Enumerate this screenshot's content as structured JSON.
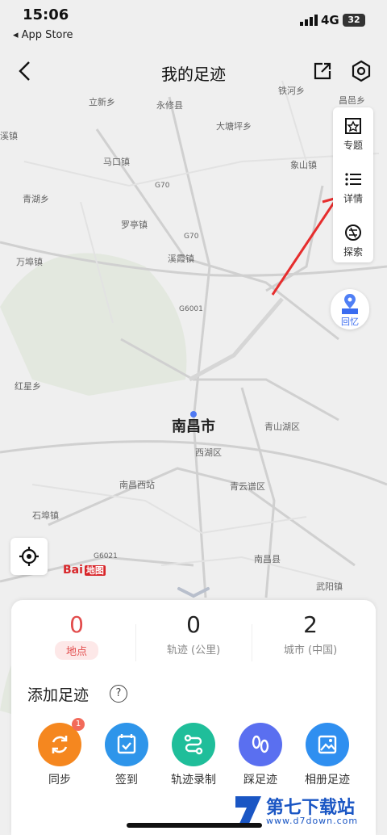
{
  "status_bar": {
    "time": "15:06",
    "back_app": "◂ App Store",
    "network": "4G",
    "battery": "32"
  },
  "header": {
    "title": "我的足迹"
  },
  "side_panel": {
    "items": [
      {
        "label": "专题"
      },
      {
        "label": "详情"
      },
      {
        "label": "探索"
      }
    ]
  },
  "memory_button": {
    "label": "回忆"
  },
  "map": {
    "city_label": "南昌市",
    "labels": [
      "立新乡",
      "永修县",
      "大塘坪乡",
      "马口镇",
      "象山镇",
      "铁河乡",
      "昌邑乡",
      "青湖乡",
      "罗亭镇",
      "溪霞镇",
      "万埠镇",
      "红星乡",
      "青山湖区",
      "西湖区",
      "南昌西站",
      "青云谱区",
      "石埠镇",
      "南昌县",
      "武阳镇",
      "溪镇",
      "G70",
      "G70",
      "G6001",
      "G6021"
    ],
    "logo": "Bai",
    "logo_map_word": "地图"
  },
  "stats": [
    {
      "value": "0",
      "label": "地点"
    },
    {
      "value": "0",
      "label": "轨迹 (公里)"
    },
    {
      "value": "2",
      "label": "城市 (中国)"
    }
  ],
  "add_section": {
    "title": "添加足迹",
    "help": "?"
  },
  "actions": [
    {
      "label": "同步",
      "badge": "1",
      "color": "#f5871f"
    },
    {
      "label": "签到",
      "color": "#2e95ea"
    },
    {
      "label": "轨迹录制",
      "color": "#1fbe9a"
    },
    {
      "label": "踩足迹",
      "color": "#5a6ff0"
    },
    {
      "label": "相册足迹",
      "color": "#2f8ff0"
    }
  ],
  "watermark": {
    "text": "第七下载站",
    "url": "www.d7down.com"
  }
}
